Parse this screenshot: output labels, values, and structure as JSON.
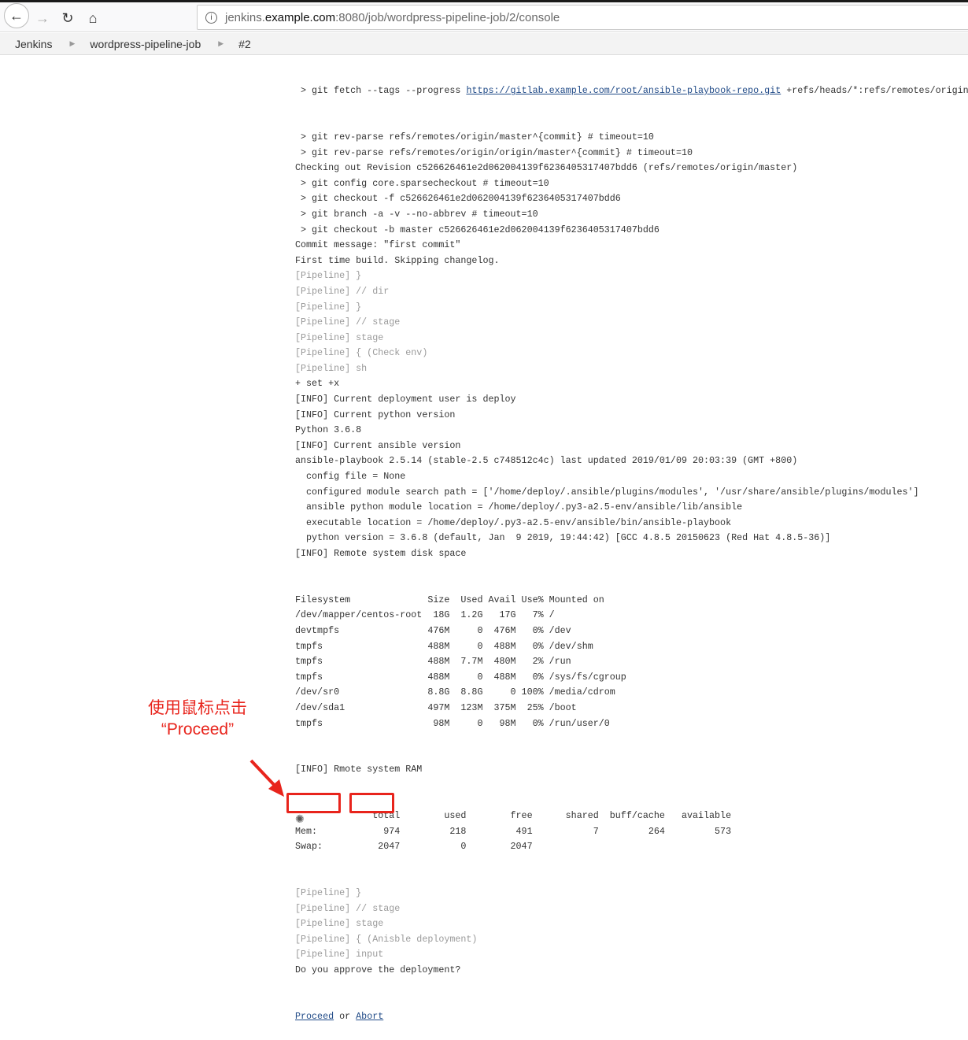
{
  "browser": {
    "url_prefix": "jenkins.",
    "url_host": "example.com",
    "url_suffix": ":8080/job/wordpress-pipeline-job/2/console"
  },
  "breadcrumb": [
    "Jenkins",
    "wordpress-pipeline-job",
    "#2"
  ],
  "console": {
    "first_line": {
      "prefix": " > git fetch --tags --progress ",
      "link": "https://gitlab.example.com/root/ansible-playbook-repo.git",
      "suffix": " +refs/heads/*:refs/remotes/origin"
    },
    "lines_a": [
      {
        "t": " > git rev-parse refs/remotes/origin/master^{commit} # timeout=10"
      },
      {
        "t": " > git rev-parse refs/remotes/origin/origin/master^{commit} # timeout=10"
      },
      {
        "t": "Checking out Revision c526626461e2d062004139f6236405317407bdd6 (refs/remotes/origin/master)"
      },
      {
        "t": " > git config core.sparsecheckout # timeout=10"
      },
      {
        "t": " > git checkout -f c526626461e2d062004139f6236405317407bdd6"
      },
      {
        "t": " > git branch -a -v --no-abbrev # timeout=10"
      },
      {
        "t": " > git checkout -b master c526626461e2d062004139f6236405317407bdd6"
      },
      {
        "t": "Commit message: \"first commit\""
      },
      {
        "t": "First time build. Skipping changelog."
      },
      {
        "t": "[Pipeline] }",
        "p": true
      },
      {
        "t": "[Pipeline] // dir",
        "p": true
      },
      {
        "t": "[Pipeline] }",
        "p": true
      },
      {
        "t": "[Pipeline] // stage",
        "p": true
      },
      {
        "t": "[Pipeline] stage",
        "p": true
      },
      {
        "t": "[Pipeline] { (Check env)",
        "p": true
      },
      {
        "t": "[Pipeline] sh",
        "p": true
      },
      {
        "t": "+ set +x"
      },
      {
        "t": "[INFO] Current deployment user is deploy"
      },
      {
        "t": "[INFO] Current python version"
      },
      {
        "t": "Python 3.6.8"
      },
      {
        "t": "[INFO] Current ansible version"
      },
      {
        "t": "ansible-playbook 2.5.14 (stable-2.5 c748512c4c) last updated 2019/01/09 20:03:39 (GMT +800)"
      },
      {
        "t": "  config file = None"
      },
      {
        "t": "  configured module search path = ['/home/deploy/.ansible/plugins/modules', '/usr/share/ansible/plugins/modules']"
      },
      {
        "t": "  ansible python module location = /home/deploy/.py3-a2.5-env/ansible/lib/ansible"
      },
      {
        "t": "  executable location = /home/deploy/.py3-a2.5-env/ansible/bin/ansible-playbook"
      },
      {
        "t": "  python version = 3.6.8 (default, Jan  9 2019, 19:44:42) [GCC 4.8.5 20150623 (Red Hat 4.8.5-36)]"
      },
      {
        "t": "[INFO] Remote system disk space"
      }
    ],
    "disk_table": {
      "headers": [
        "Filesystem",
        "Size",
        "Used",
        "Avail",
        "Use%",
        "Mounted on"
      ],
      "rows": [
        [
          "/dev/mapper/centos-root",
          "18G",
          "1.2G",
          "17G",
          "7%",
          "/"
        ],
        [
          "devtmpfs",
          "476M",
          "0",
          "476M",
          "0%",
          "/dev"
        ],
        [
          "tmpfs",
          "488M",
          "0",
          "488M",
          "0%",
          "/dev/shm"
        ],
        [
          "tmpfs",
          "488M",
          "7.7M",
          "480M",
          "2%",
          "/run"
        ],
        [
          "tmpfs",
          "488M",
          "0",
          "488M",
          "0%",
          "/sys/fs/cgroup"
        ],
        [
          "/dev/sr0",
          "8.8G",
          "8.8G",
          "0",
          "100%",
          "/media/cdrom"
        ],
        [
          "/dev/sda1",
          "497M",
          "123M",
          "375M",
          "25%",
          "/boot"
        ],
        [
          "tmpfs",
          "98M",
          "0",
          "98M",
          "0%",
          "/run/user/0"
        ]
      ]
    },
    "ram_title": "[INFO] Rmote system RAM",
    "ram_table": {
      "headers": [
        "total",
        "used",
        "free",
        "shared",
        "buff/cache",
        "available"
      ],
      "rows": [
        [
          "Mem:",
          "974",
          "218",
          "491",
          "7",
          "264",
          "573"
        ],
        [
          "Swap:",
          "2047",
          "0",
          "2047"
        ]
      ]
    },
    "lines_b": [
      {
        "t": "[Pipeline] }",
        "p": true
      },
      {
        "t": "[Pipeline] // stage",
        "p": true
      },
      {
        "t": "[Pipeline] stage",
        "p": true
      },
      {
        "t": "[Pipeline] { (Anisble deployment)",
        "p": true
      },
      {
        "t": "[Pipeline] input",
        "p": true
      },
      {
        "t": "Do you approve the deployment?"
      }
    ],
    "proceed_label": "Proceed",
    "or_label": "or",
    "abort_label": "Abort"
  },
  "annotation": {
    "line1": "使用鼠标点击",
    "line2": "“Proceed”",
    "color": "#e8241c"
  }
}
